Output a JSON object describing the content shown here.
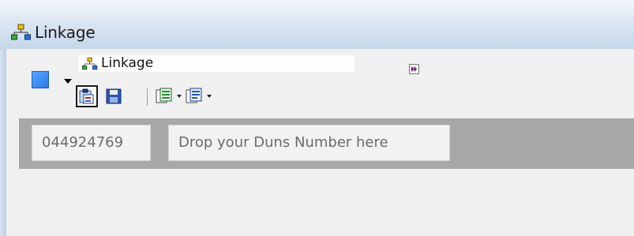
{
  "window": {
    "title": "Linkage",
    "title_icon": "hierarchy-icon"
  },
  "document": {
    "title": "Linkage",
    "title_icon": "hierarchy-icon",
    "expand_icon": "fast-forward-icon"
  },
  "color_picker": {
    "color": "#3b86f0",
    "icon": "color-swatch"
  },
  "toolbar": {
    "buttons": [
      {
        "icon": "paste-link-icon",
        "active": true
      },
      {
        "icon": "save-icon",
        "active": false
      },
      {
        "icon": "export-excel-icon",
        "active": false,
        "has_dropdown": true
      },
      {
        "icon": "export-word-icon",
        "active": false,
        "has_dropdown": true
      }
    ]
  },
  "duns": {
    "value": "044924769",
    "drop_placeholder": "Drop your Duns Number here"
  },
  "colors": {
    "titlebar_gradient_top": "#f3f6fa",
    "titlebar_gradient_bottom": "#c6d7ea",
    "panel_bg": "#f0f0f0",
    "inputbar_bg": "#a8a8a8",
    "field_bg": "#f2f2f2",
    "field_text": "#6b6b6b"
  }
}
